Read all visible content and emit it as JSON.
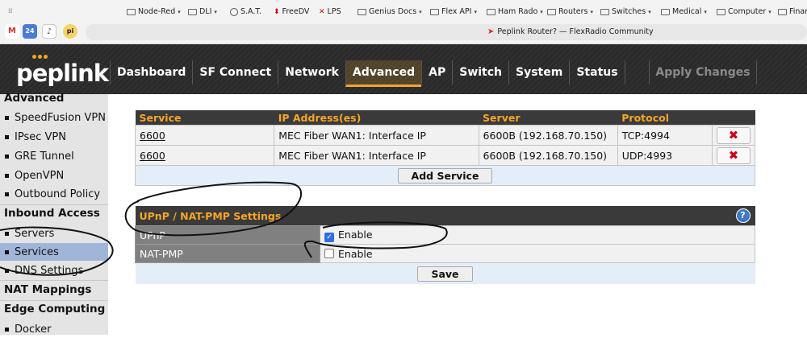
{
  "bookmarks": [
    {
      "label": "Node-Red",
      "chevron": true
    },
    {
      "label": "DLI",
      "chevron": true
    },
    {
      "label": "S.A.T.",
      "chevron": false
    },
    {
      "label": "FreeDV",
      "chevron": false
    },
    {
      "label": "LPS",
      "chevron": false
    },
    {
      "label": "Genius Docs",
      "chevron": true
    },
    {
      "label": "Flex API",
      "chevron": true
    },
    {
      "label": "Ham Rado",
      "chevron": true
    },
    {
      "label": "Routers",
      "chevron": true
    },
    {
      "label": "Switches",
      "chevron": true
    },
    {
      "label": "Medical",
      "chevron": true
    },
    {
      "label": "Computer",
      "chevron": true
    },
    {
      "label": "Finan",
      "chevron": false
    }
  ],
  "tab": {
    "title": "Peplink Router? — FlexRadio Community"
  },
  "favicons": [
    "M",
    "24",
    "♪",
    "pi"
  ],
  "logo": {
    "text": "peplink"
  },
  "nav": {
    "items": [
      "Dashboard",
      "SF Connect",
      "Network",
      "Advanced",
      "AP",
      "Switch",
      "System",
      "Status"
    ],
    "active": "Advanced",
    "apply": "Apply Changes"
  },
  "sidebar": {
    "advanced_head": "Advanced",
    "advanced_items": [
      "SpeedFusion VPN",
      "IPsec VPN",
      "GRE Tunnel",
      "OpenVPN",
      "Outbound Policy"
    ],
    "inbound_head": "Inbound Access",
    "inbound_items": [
      "Servers",
      "Services",
      "DNS Settings"
    ],
    "selected": "Services",
    "nat_head": "NAT Mappings",
    "edge_head": "Edge Computing",
    "edge_items": [
      "Docker"
    ]
  },
  "services": {
    "headers": [
      "Service",
      "IP Address(es)",
      "Server",
      "Protocol"
    ],
    "rows": [
      {
        "service": "6600",
        "ip": "MEC Fiber WAN1: Interface IP",
        "server": "6600B (192.168.70.150)",
        "protocol": "TCP:4994"
      },
      {
        "service": "6600",
        "ip": "MEC Fiber WAN1: Interface IP",
        "server": "6600B (192.168.70.150)",
        "protocol": "UDP:4993"
      }
    ],
    "add_button": "Add Service"
  },
  "upnp": {
    "title": "UPnP / NAT-PMP Settings",
    "help": "?",
    "rows": [
      {
        "label": "UPnP",
        "option": "Enable",
        "checked": true
      },
      {
        "label": "NAT-PMP",
        "option": "Enable",
        "checked": false
      }
    ],
    "save_button": "Save"
  },
  "colors": {
    "accent": "#f5a623",
    "selected": "#9fb6d8",
    "delete": "#d0021b",
    "header": "#2a2a2a"
  }
}
